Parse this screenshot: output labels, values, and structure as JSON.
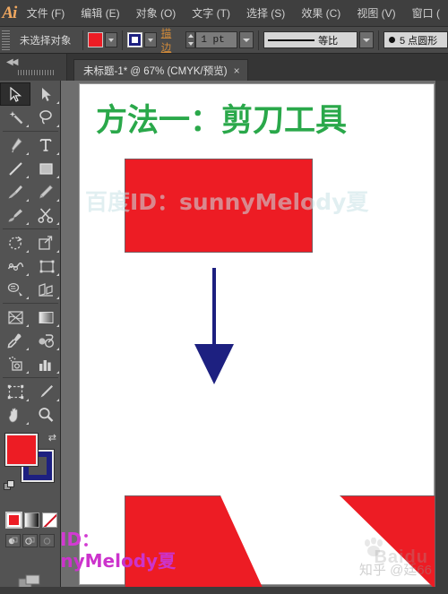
{
  "app": {
    "logo": "Ai"
  },
  "menu": {
    "items": [
      {
        "label": "文件 (F)",
        "name": "menu-file"
      },
      {
        "label": "编辑 (E)",
        "name": "menu-edit"
      },
      {
        "label": "对象 (O)",
        "name": "menu-object"
      },
      {
        "label": "文字 (T)",
        "name": "menu-type"
      },
      {
        "label": "选择 (S)",
        "name": "menu-select"
      },
      {
        "label": "效果 (C)",
        "name": "menu-effect"
      },
      {
        "label": "视图 (V)",
        "name": "menu-view"
      },
      {
        "label": "窗口 (",
        "name": "menu-window"
      }
    ]
  },
  "control_bar": {
    "selection_status": "未选择对象",
    "fill_color": "#ed1c24",
    "stroke_color": "#1d2080",
    "stroke_label": "描边",
    "stroke_weight": "1 pt",
    "profile_label": "等比",
    "brush_label": "5 点圆形"
  },
  "tabs": {
    "document": "未标题-1* @ 67% (CMYK/预览)",
    "close_glyph": "×",
    "collapse_glyph": "◀◀"
  },
  "tools": [
    {
      "name": "selection-tool",
      "label": "选择工具"
    },
    {
      "name": "direct-selection-tool",
      "label": "直接选择工具"
    },
    {
      "name": "magic-wand-tool",
      "label": "魔棒工具"
    },
    {
      "name": "lasso-tool",
      "label": "套索工具"
    },
    {
      "name": "pen-tool",
      "label": "钢笔工具"
    },
    {
      "name": "type-tool",
      "label": "文字工具"
    },
    {
      "name": "line-segment-tool",
      "label": "直线段工具"
    },
    {
      "name": "rectangle-tool",
      "label": "矩形工具"
    },
    {
      "name": "paintbrush-tool",
      "label": "画笔工具"
    },
    {
      "name": "pencil-tool",
      "label": "铅笔工具"
    },
    {
      "name": "blob-brush-tool",
      "label": "斑点画笔工具"
    },
    {
      "name": "scissors-tool",
      "label": "剪刀工具"
    },
    {
      "name": "rotate-tool",
      "label": "旋转工具"
    },
    {
      "name": "scale-tool",
      "label": "比例缩放工具"
    },
    {
      "name": "width-tool",
      "label": "宽度工具"
    },
    {
      "name": "free-transform-tool",
      "label": "自由变换工具"
    },
    {
      "name": "shape-builder-tool",
      "label": "形状生成器工具"
    },
    {
      "name": "perspective-grid-tool",
      "label": "透视网格工具"
    },
    {
      "name": "mesh-tool",
      "label": "网格工具"
    },
    {
      "name": "gradient-tool",
      "label": "渐变工具"
    },
    {
      "name": "eyedropper-tool",
      "label": "吸管工具"
    },
    {
      "name": "blend-tool",
      "label": "混合工具"
    },
    {
      "name": "symbol-sprayer-tool",
      "label": "符号喷枪工具"
    },
    {
      "name": "column-graph-tool",
      "label": "柱形图工具"
    },
    {
      "name": "artboard-tool",
      "label": "画板工具"
    },
    {
      "name": "slice-tool",
      "label": "切片工具"
    },
    {
      "name": "hand-tool",
      "label": "抓手工具"
    },
    {
      "name": "zoom-tool",
      "label": "缩放工具"
    }
  ],
  "color_panel": {
    "fill": "#ed1c24",
    "stroke": "#1d2080",
    "swap_glyph": "⇄",
    "modes": [
      "color",
      "gradient",
      "none"
    ],
    "selected_mode": "color"
  },
  "artboard": {
    "title": "方法一：剪刀工具",
    "title_color": "#2aa84a",
    "watermark_canvas": "百度ID：sunnyMelody夏",
    "shape_fill": "#ed1c24",
    "arrow_color": "#1d2080",
    "watermark_bottom_line1": "百度ID：",
    "watermark_bottom_line2": "sunnyMelody夏",
    "watermark_bottom_color": "#cc33cc",
    "watermark_baidu": "Baidu",
    "watermark_zhihu": "知乎 @廷66"
  }
}
